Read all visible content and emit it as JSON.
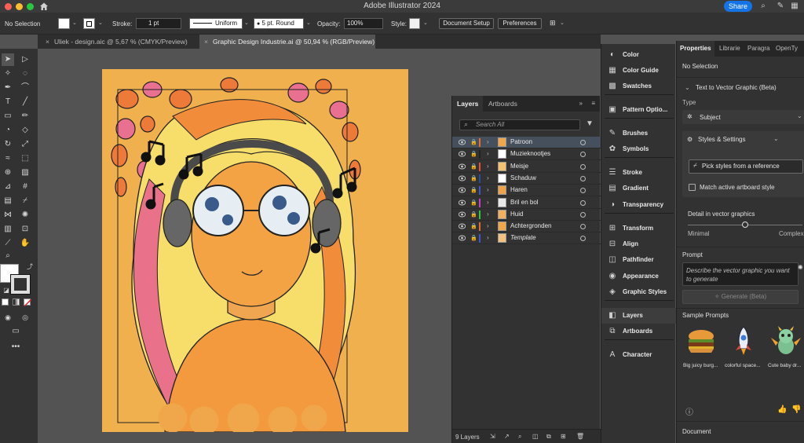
{
  "app": {
    "title": "Adobe Illustrator 2024",
    "share_label": "Share"
  },
  "control_bar": {
    "selection_label": "No Selection",
    "stroke_label": "Stroke:",
    "stroke_weight": "1 pt",
    "stroke_profile": "Uniform",
    "brush": "5 pt. Round",
    "opacity_label": "Opacity:",
    "opacity_value": "100%",
    "style_label": "Style:",
    "document_setup": "Document Setup",
    "preferences": "Preferences"
  },
  "document_tabs": [
    {
      "label": "Uliek - design.aic @ 5,67 % (CMYK/Preview)"
    },
    {
      "label": "Graphic Design Industrie.ai @ 50,94 % (RGB/Preview)"
    }
  ],
  "layers_panel": {
    "tabs": [
      "Layers",
      "Artboards"
    ],
    "search_placeholder": "Search All",
    "layers": [
      {
        "name": "Patroon",
        "color": "#e46b3a",
        "thumb": "#f0a64a"
      },
      {
        "name": "Muzieknootjes",
        "color": "#222222",
        "thumb": "#ffffff"
      },
      {
        "name": "Meisje",
        "color": "#e0503a",
        "thumb": "#f5c070"
      },
      {
        "name": "Schaduw",
        "color": "#2b4c9e",
        "thumb": "#ffffff"
      },
      {
        "name": "Haren",
        "color": "#3e55c9",
        "thumb": "#f0a24a"
      },
      {
        "name": "Bril en bol",
        "color": "#c040c8",
        "thumb": "#e8e8e8"
      },
      {
        "name": "Huid",
        "color": "#34c43e",
        "thumb": "#f0b060"
      },
      {
        "name": "Achtergronden",
        "color": "#e06a30",
        "thumb": "#f0a64a"
      },
      {
        "name": "Template",
        "color": "#3e55c9",
        "thumb": "#f2c080"
      }
    ],
    "count_label": "9 Layers"
  },
  "dock_panels": [
    {
      "label": "Color",
      "icon": "color-icon"
    },
    {
      "label": "Color Guide",
      "icon": "color-guide-icon"
    },
    {
      "label": "Swatches",
      "icon": "swatches-icon"
    },
    {
      "label": "Pattern Optio...",
      "icon": "pattern-options-icon"
    },
    {
      "label": "Brushes",
      "icon": "brushes-icon"
    },
    {
      "label": "Symbols",
      "icon": "symbols-icon"
    },
    {
      "label": "Stroke",
      "icon": "stroke-icon"
    },
    {
      "label": "Gradient",
      "icon": "gradient-icon"
    },
    {
      "label": "Transparency",
      "icon": "transparency-icon"
    },
    {
      "label": "Transform",
      "icon": "transform-icon"
    },
    {
      "label": "Align",
      "icon": "align-icon"
    },
    {
      "label": "Pathfinder",
      "icon": "pathfinder-icon"
    },
    {
      "label": "Appearance",
      "icon": "appearance-icon"
    },
    {
      "label": "Graphic Styles",
      "icon": "graphic-styles-icon"
    },
    {
      "label": "Layers",
      "icon": "layers-icon"
    },
    {
      "label": "Artboards",
      "icon": "artboards-icon"
    },
    {
      "label": "Character",
      "icon": "character-icon"
    }
  ],
  "properties_panel": {
    "tabs": [
      "Properties",
      "Librarie",
      "Paragra",
      "OpenTy"
    ],
    "selection": "No Selection",
    "section_title": "Text to Vector Graphic (Beta)",
    "type_label": "Type",
    "type_value": "Subject",
    "styles_settings": "Styles & Settings",
    "pick_styles": "Pick styles from a reference",
    "match_artboard": "Match active artboard style",
    "detail_label": "Detail in vector graphics",
    "detail_min": "Minimal",
    "detail_max": "Complex",
    "detail_level": 0.5,
    "prompt_label": "Prompt",
    "prompt_placeholder": "Describe the vector graphic you want to generate",
    "generate_label": "Generate (Beta)",
    "sample_prompts_label": "Sample Prompts",
    "samples": [
      "Big juicy burg...",
      "colorful space...",
      "Cute baby dr..."
    ],
    "document_label": "Document"
  }
}
